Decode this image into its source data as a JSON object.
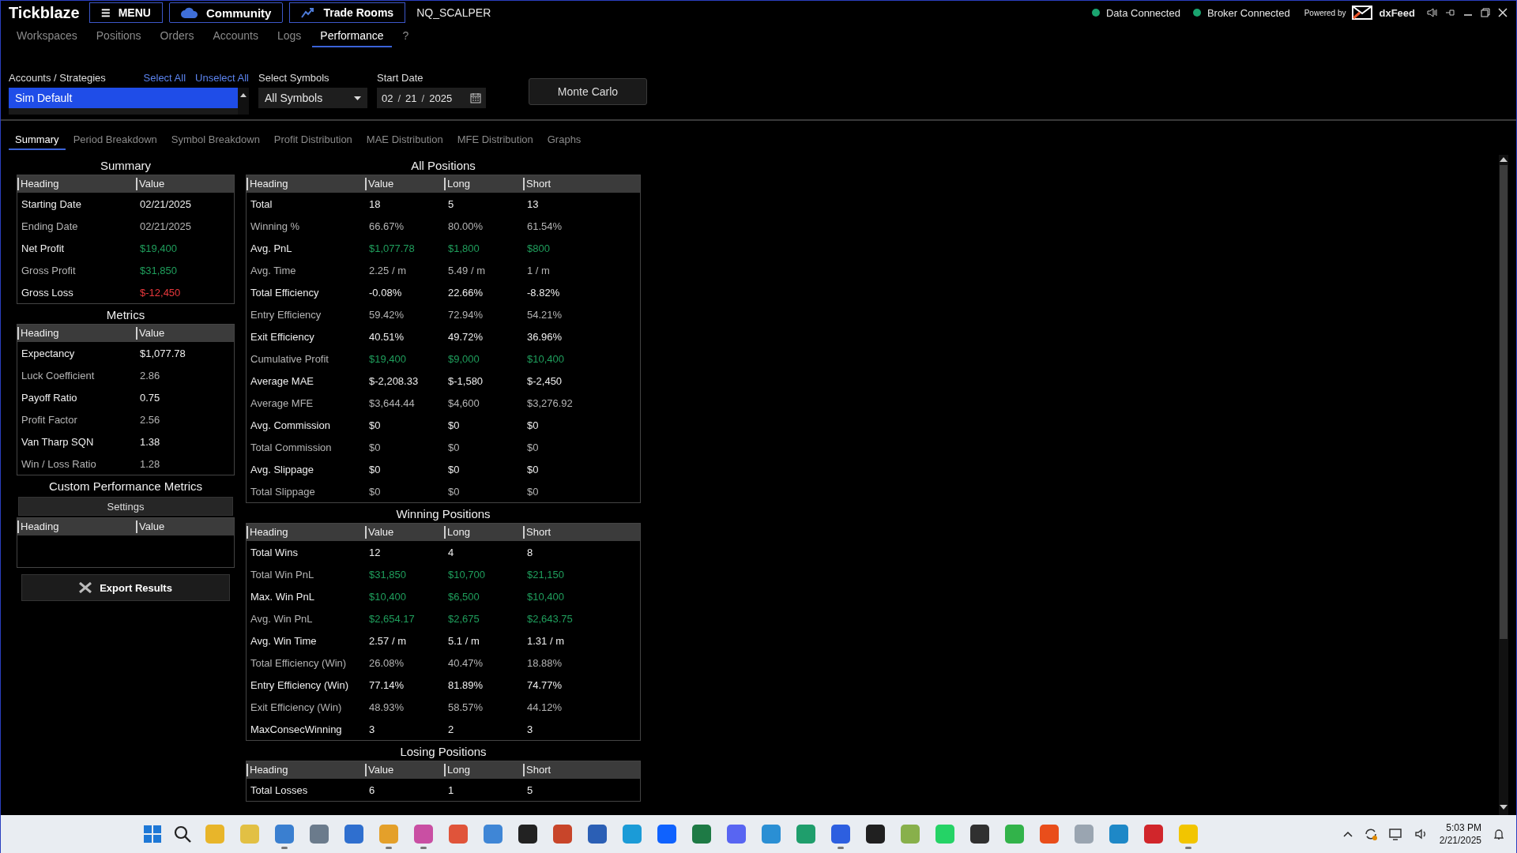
{
  "app": {
    "title": "Tickblaze",
    "menu": "MENU",
    "menu_glyph": "☰",
    "community": "Community",
    "trade_rooms": "Trade Rooms",
    "workspace": "NQ_SCALPER"
  },
  "status": [
    {
      "label": "Data Connected",
      "color": "#1aa36f"
    },
    {
      "label": "Broker Connected",
      "color": "#1aa36f"
    }
  ],
  "powered_by": {
    "prefix": "Powered by",
    "name": "dxFeed"
  },
  "nav_tabs": [
    {
      "label": "Workspaces",
      "selected": false
    },
    {
      "label": "Positions",
      "selected": false
    },
    {
      "label": "Orders",
      "selected": false
    },
    {
      "label": "Accounts",
      "selected": false
    },
    {
      "label": "Logs",
      "selected": false
    },
    {
      "label": "Performance",
      "selected": true
    },
    {
      "label": "?",
      "selected": false
    }
  ],
  "filters": {
    "accounts_label": "Accounts / Strategies",
    "select_all": "Select All",
    "unselect_all": "Unselect All",
    "accounts": [
      {
        "label": "Sim Default",
        "selected": true
      }
    ],
    "symbols_label": "Select Symbols",
    "symbols_value": "All Symbols",
    "date_label": "Start Date",
    "date": {
      "month": "02",
      "day": "21",
      "year": "2025",
      "separator": "/"
    },
    "monte_carlo": "Monte Carlo"
  },
  "sub_tabs": [
    {
      "label": "Summary",
      "selected": true
    },
    {
      "label": "Period Breakdown",
      "selected": false
    },
    {
      "label": "Symbol Breakdown",
      "selected": false
    },
    {
      "label": "Profit Distribution",
      "selected": false
    },
    {
      "label": "MAE Distribution",
      "selected": false
    },
    {
      "label": "MFE Distribution",
      "selected": false
    },
    {
      "label": "Graphs",
      "selected": false
    }
  ],
  "left_tables": [
    {
      "title": "Summary",
      "columns": [
        "Heading",
        "Value"
      ],
      "rows": [
        {
          "cells": [
            "Starting Date",
            "02/21/2025"
          ],
          "kind": "plain"
        },
        {
          "cells": [
            "Ending Date",
            "02/21/2025"
          ],
          "kind": "plain"
        },
        {
          "cells": [
            "Net Profit",
            "$19,400"
          ],
          "kind": "gain"
        },
        {
          "cells": [
            "Gross Profit",
            "$31,850"
          ],
          "kind": "gain"
        },
        {
          "cells": [
            "Gross Loss",
            "$-12,450"
          ],
          "kind": "loss"
        }
      ]
    },
    {
      "title": "Metrics",
      "columns": [
        "Heading",
        "Value"
      ],
      "rows": [
        {
          "cells": [
            "Expectancy",
            "$1,077.78"
          ],
          "kind": "plain"
        },
        {
          "cells": [
            "Luck Coefficient",
            "2.86"
          ],
          "kind": "plain"
        },
        {
          "cells": [
            "Payoff Ratio",
            "0.75"
          ],
          "kind": "plain"
        },
        {
          "cells": [
            "Profit Factor",
            "2.56"
          ],
          "kind": "plain"
        },
        {
          "cells": [
            "Van Tharp SQN",
            "1.38"
          ],
          "kind": "plain"
        },
        {
          "cells": [
            "Win / Loss Ratio",
            "1.28"
          ],
          "kind": "plain"
        }
      ]
    }
  ],
  "custom_metrics": {
    "title": "Custom Performance Metrics",
    "settings": "Settings",
    "columns": [
      "Heading",
      "Value"
    ]
  },
  "export": "Export Results",
  "right_tables": [
    {
      "title": "All Positions",
      "columns": [
        "Heading",
        "Value",
        "Long",
        "Short"
      ],
      "rows": [
        {
          "cells": [
            "Total",
            "18",
            "5",
            "13"
          ],
          "kind": "plain"
        },
        {
          "cells": [
            "Winning %",
            "66.67%",
            "80.00%",
            "61.54%"
          ],
          "kind": "plain"
        },
        {
          "cells": [
            "Avg. PnL",
            "$1,077.78",
            "$1,800",
            "$800"
          ],
          "kind": "gain"
        },
        {
          "cells": [
            "Avg. Time",
            "2.25 / m",
            "5.49 / m",
            "1 / m"
          ],
          "kind": "plain"
        },
        {
          "cells": [
            "Total Efficiency",
            "-0.08%",
            "22.66%",
            "-8.82%"
          ],
          "kind": "plain"
        },
        {
          "cells": [
            "Entry Efficiency",
            "59.42%",
            "72.94%",
            "54.21%"
          ],
          "kind": "plain"
        },
        {
          "cells": [
            "Exit Efficiency",
            "40.51%",
            "49.72%",
            "36.96%"
          ],
          "kind": "plain"
        },
        {
          "cells": [
            "Cumulative Profit",
            "$19,400",
            "$9,000",
            "$10,400"
          ],
          "kind": "gain"
        },
        {
          "cells": [
            "Average MAE",
            "$-2,208.33",
            "$-1,580",
            "$-2,450"
          ],
          "kind": "plain"
        },
        {
          "cells": [
            "Average MFE",
            "$3,644.44",
            "$4,600",
            "$3,276.92"
          ],
          "kind": "plain"
        },
        {
          "cells": [
            "Avg. Commission",
            "$0",
            "$0",
            "$0"
          ],
          "kind": "plain"
        },
        {
          "cells": [
            "Total Commission",
            "$0",
            "$0",
            "$0"
          ],
          "kind": "plain"
        },
        {
          "cells": [
            "Avg. Slippage",
            "$0",
            "$0",
            "$0"
          ],
          "kind": "plain"
        },
        {
          "cells": [
            "Total Slippage",
            "$0",
            "$0",
            "$0"
          ],
          "kind": "plain"
        }
      ]
    },
    {
      "title": "Winning Positions",
      "columns": [
        "Heading",
        "Value",
        "Long",
        "Short"
      ],
      "rows": [
        {
          "cells": [
            "Total Wins",
            "12",
            "4",
            "8"
          ],
          "kind": "plain"
        },
        {
          "cells": [
            "Total Win PnL",
            "$31,850",
            "$10,700",
            "$21,150"
          ],
          "kind": "gain"
        },
        {
          "cells": [
            "Max. Win PnL",
            "$10,400",
            "$6,500",
            "$10,400"
          ],
          "kind": "gain"
        },
        {
          "cells": [
            "Avg. Win PnL",
            "$2,654.17",
            "$2,675",
            "$2,643.75"
          ],
          "kind": "gain"
        },
        {
          "cells": [
            "Avg. Win Time",
            "2.57 / m",
            "5.1 / m",
            "1.31 / m"
          ],
          "kind": "plain"
        },
        {
          "cells": [
            "Total Efficiency (Win)",
            "26.08%",
            "40.47%",
            "18.88%"
          ],
          "kind": "plain"
        },
        {
          "cells": [
            "Entry Efficiency (Win)",
            "77.14%",
            "81.89%",
            "74.77%"
          ],
          "kind": "plain"
        },
        {
          "cells": [
            "Exit Efficiency (Win)",
            "48.93%",
            "58.57%",
            "44.12%"
          ],
          "kind": "plain"
        },
        {
          "cells": [
            "MaxConsecWinning",
            "3",
            "2",
            "3"
          ],
          "kind": "plain"
        }
      ]
    },
    {
      "title": "Losing Positions",
      "columns": [
        "Heading",
        "Value",
        "Long",
        "Short"
      ],
      "rows": [
        {
          "cells": [
            "Total Losses",
            "6",
            "1",
            "5"
          ],
          "kind": "plain"
        }
      ]
    }
  ],
  "taskbar": {
    "apps": [
      {
        "color": "#e8b52a",
        "open": false
      },
      {
        "color": "#e2c044",
        "open": false
      },
      {
        "color": "#3a7fd0",
        "open": true
      },
      {
        "color": "#6b7b8c",
        "open": false
      },
      {
        "color": "#2f6fcf",
        "open": false
      },
      {
        "color": "#e4a02a",
        "open": true
      },
      {
        "color": "#c94fa3",
        "open": true
      },
      {
        "color": "#e0543a",
        "open": false
      },
      {
        "color": "#3f86d6",
        "open": false
      },
      {
        "color": "#222222",
        "open": false
      },
      {
        "color": "#c8452a",
        "open": false
      },
      {
        "color": "#2b5fb5",
        "open": false
      },
      {
        "color": "#1b9bd7",
        "open": false
      },
      {
        "color": "#0f62fe",
        "open": false
      },
      {
        "color": "#1e7a45",
        "open": false
      },
      {
        "color": "#5865f2",
        "open": false
      },
      {
        "color": "#2a8fd4",
        "open": false
      },
      {
        "color": "#1f9e6c",
        "open": false
      },
      {
        "color": "#2d5fe0",
        "open": true
      },
      {
        "color": "#202020",
        "open": false
      },
      {
        "color": "#88b04b",
        "open": false
      },
      {
        "color": "#25d366",
        "open": false
      },
      {
        "color": "#303030",
        "open": false
      },
      {
        "color": "#32b34a",
        "open": false
      },
      {
        "color": "#e94e1b",
        "open": false
      },
      {
        "color": "#9aa5b1",
        "open": false
      },
      {
        "color": "#1e88c7",
        "open": false
      },
      {
        "color": "#d1262b",
        "open": false
      },
      {
        "color": "#f2c500",
        "open": true
      }
    ],
    "time": "5:03 PM",
    "date": "2/21/2025"
  }
}
